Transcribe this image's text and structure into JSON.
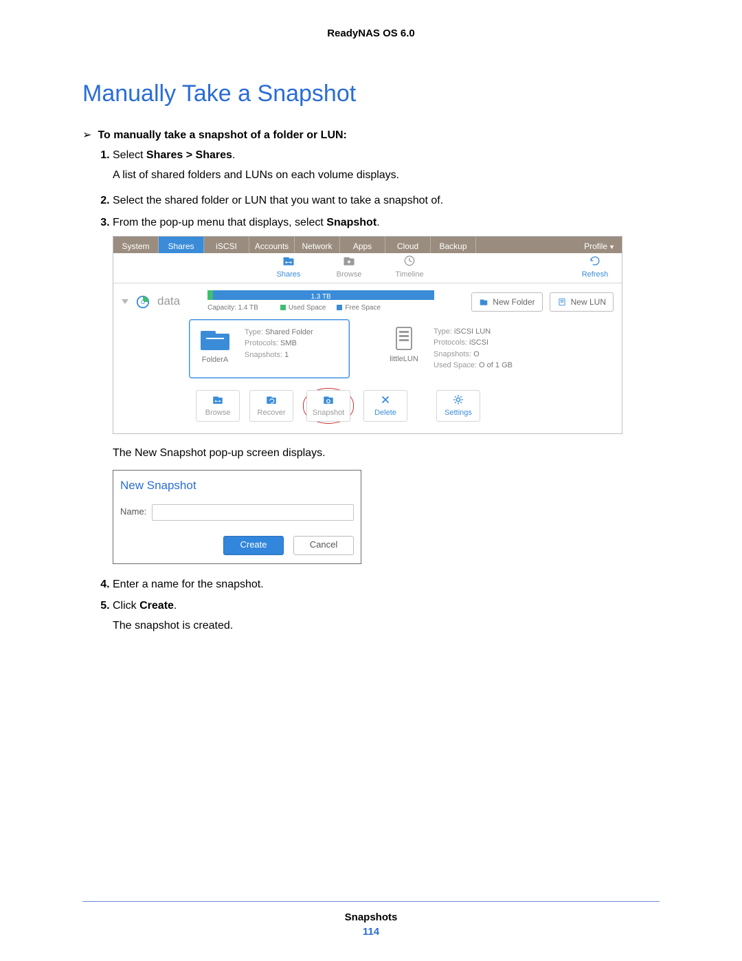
{
  "header": "ReadyNAS OS 6.0",
  "title": "Manually Take a Snapshot",
  "lead_arrow": "➢",
  "lead": "To manually take a snapshot of a folder or LUN:",
  "steps": {
    "s1_a": "Select ",
    "s1_b": "Shares > Shares",
    "s1_c": ".",
    "s1_sub": "A list of shared folders and LUNs on each volume displays.",
    "s2": "Select the shared folder or LUN that you want to take a snapshot of.",
    "s3_a": "From the pop-up menu that displays, select ",
    "s3_b": "Snapshot",
    "s3_c": ".",
    "s3_post": "The New Snapshot pop-up screen displays.",
    "s4": "Enter a name for the snapshot.",
    "s5_a": "Click ",
    "s5_b": "Create",
    "s5_c": ".",
    "s5_sub": "The snapshot is created."
  },
  "app": {
    "tabs": [
      "System",
      "Shares",
      "iSCSI",
      "Accounts",
      "Network",
      "Apps",
      "Cloud",
      "Backup"
    ],
    "active_tab_index": 1,
    "profile": "Profile",
    "subtoolbar": {
      "shares": "Shares",
      "browse": "Browse",
      "timeline": "Timeline",
      "refresh": "Refresh"
    },
    "volume": {
      "name": "data",
      "bar_label": "1.3 TB",
      "capacity_label": "Capacity: 1.4 TB",
      "legend_used": "Used Space",
      "legend_free": "Free Space",
      "btn_newfolder": "New Folder",
      "btn_newlun": "New LUN"
    },
    "folder": {
      "name": "FolderA",
      "type_l": "Type:",
      "type_v": "Shared Folder",
      "proto_l": "Protocols:",
      "proto_v": "SMB",
      "snap_l": "Snapshots:",
      "snap_v": "1"
    },
    "lun": {
      "name": "littleLUN",
      "type_l": "Type:",
      "type_v": "iSCSI LUN",
      "proto_l": "Protocols:",
      "proto_v": "iSCSI",
      "snap_l": "Snapshots:",
      "snap_v": "O",
      "used_l": "Used Space:",
      "used_v": "O of 1 GB"
    },
    "actions": {
      "browse": "Browse",
      "recover": "Recover",
      "snapshot": "Snapshot",
      "delete": "Delete",
      "settings": "Settings"
    }
  },
  "dialog": {
    "title": "New Snapshot",
    "name_label": "Name:",
    "create": "Create",
    "cancel": "Cancel"
  },
  "footer": {
    "section": "Snapshots",
    "page": "114"
  }
}
